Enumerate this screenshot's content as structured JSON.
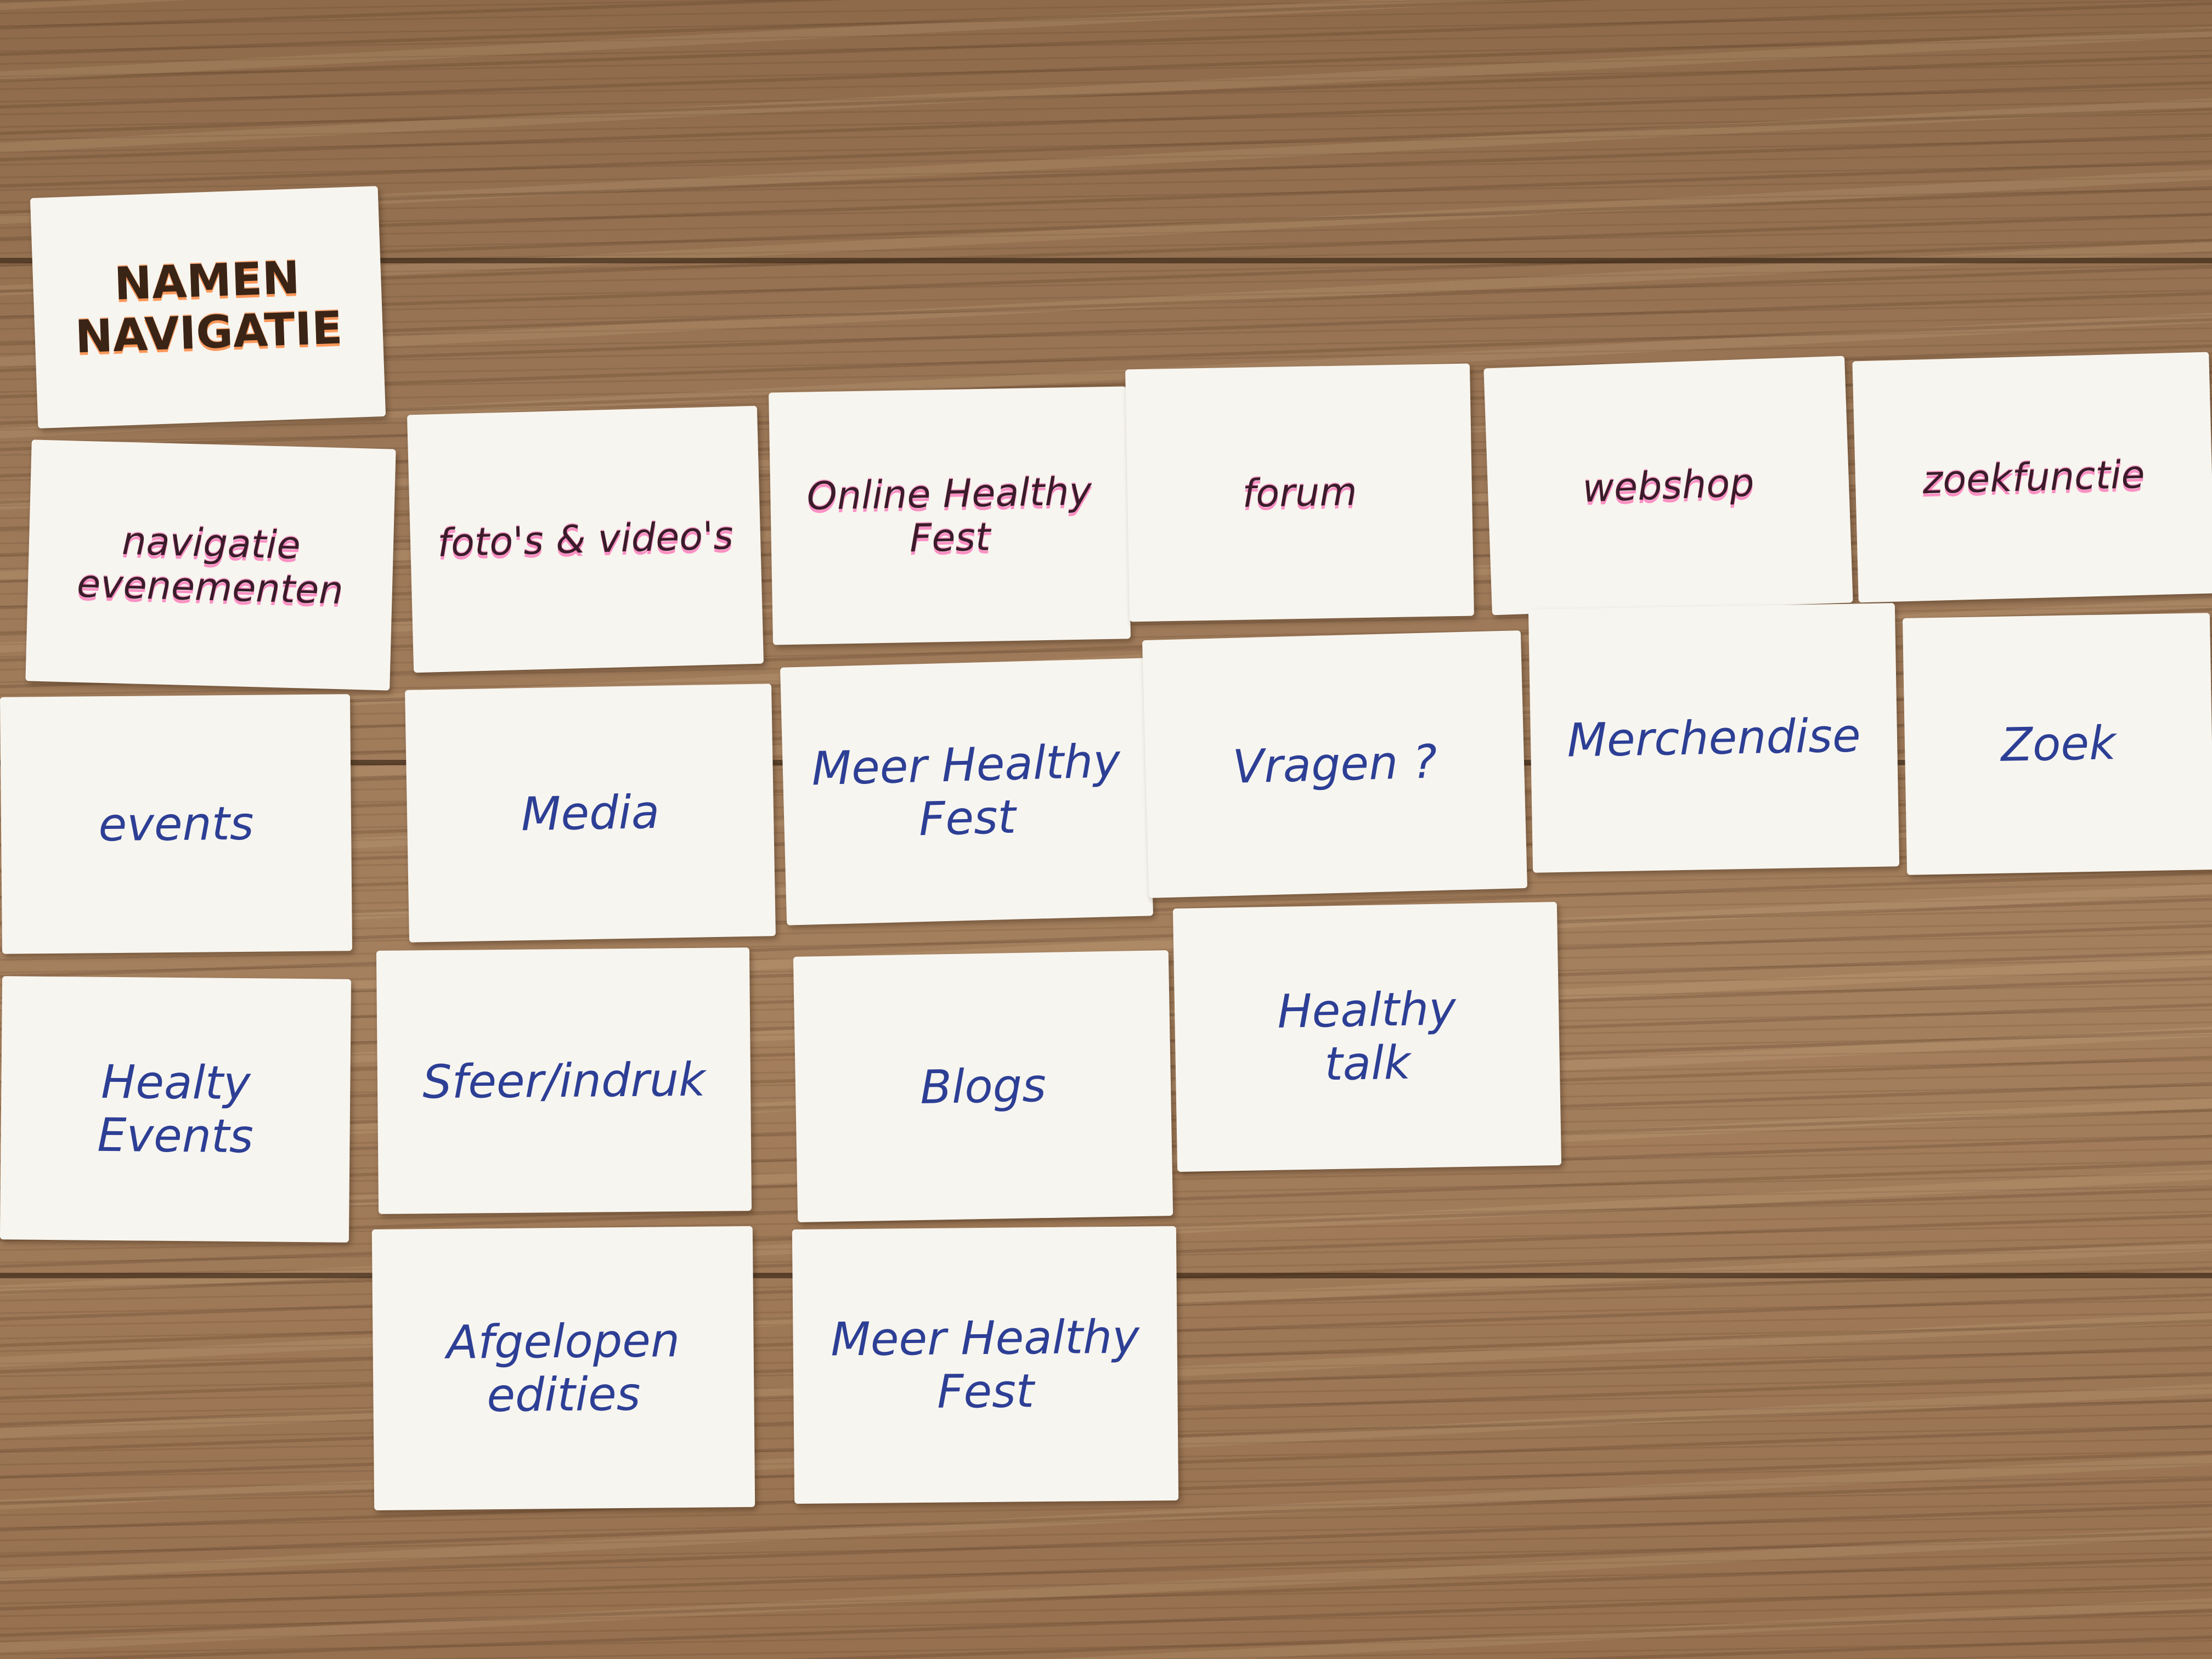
{
  "cards": {
    "header": "NAMEN\nNAVIGATIE",
    "nav_events": "navigatie\nevenementen",
    "nav_media": "foto's & video's",
    "nav_online": "Online Healthy\nFest",
    "nav_forum": "forum",
    "nav_webshop": "webshop",
    "nav_search": "zoekfunctie",
    "events": "events",
    "media": "Media",
    "meer_healthy_fest_1": "Meer Healthy\nFest",
    "vragen": "Vragen ?",
    "merchendise": "Merchendise",
    "zoek": "Zoek",
    "healty_events": "Healty\nEvents",
    "sfeer_indruk": "Sfeer/indruk",
    "blogs": "Blogs",
    "healthy_talk": "Healthy\ntalk",
    "afgelopen_edities": "Afgelopen\nedities",
    "meer_healthy_fest_2": "Meer Healthy\nFest"
  },
  "colors": {
    "table_wood": "#9c7858",
    "card_paper": "#f7f5ef",
    "ink_blue": "#2d3f95",
    "highlight_pink": "#ff3ca0",
    "highlight_orange": "#ff7828"
  }
}
